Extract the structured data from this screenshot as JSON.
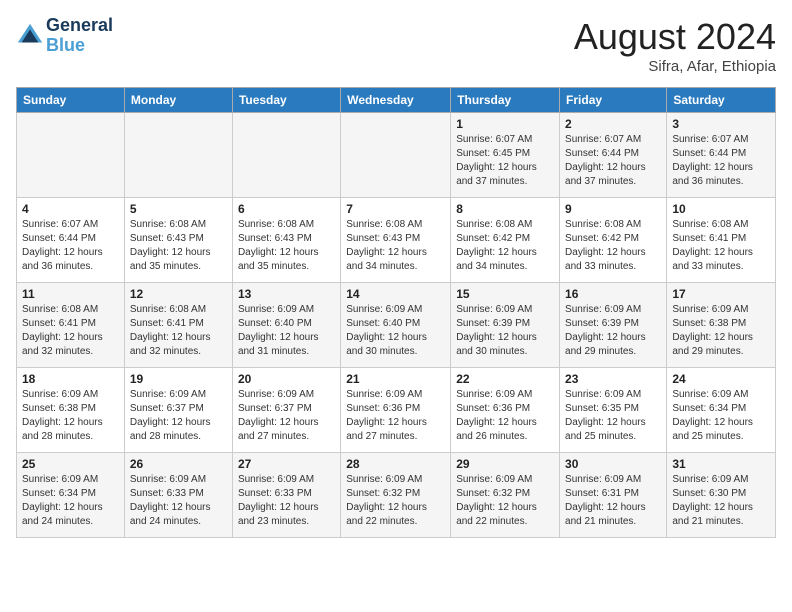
{
  "header": {
    "logo_line1": "General",
    "logo_line2": "Blue",
    "month": "August 2024",
    "location": "Sifra, Afar, Ethiopia"
  },
  "weekdays": [
    "Sunday",
    "Monday",
    "Tuesday",
    "Wednesday",
    "Thursday",
    "Friday",
    "Saturday"
  ],
  "weeks": [
    [
      {
        "day": "",
        "info": ""
      },
      {
        "day": "",
        "info": ""
      },
      {
        "day": "",
        "info": ""
      },
      {
        "day": "",
        "info": ""
      },
      {
        "day": "1",
        "info": "Sunrise: 6:07 AM\nSunset: 6:45 PM\nDaylight: 12 hours\nand 37 minutes."
      },
      {
        "day": "2",
        "info": "Sunrise: 6:07 AM\nSunset: 6:44 PM\nDaylight: 12 hours\nand 37 minutes."
      },
      {
        "day": "3",
        "info": "Sunrise: 6:07 AM\nSunset: 6:44 PM\nDaylight: 12 hours\nand 36 minutes."
      }
    ],
    [
      {
        "day": "4",
        "info": "Sunrise: 6:07 AM\nSunset: 6:44 PM\nDaylight: 12 hours\nand 36 minutes."
      },
      {
        "day": "5",
        "info": "Sunrise: 6:08 AM\nSunset: 6:43 PM\nDaylight: 12 hours\nand 35 minutes."
      },
      {
        "day": "6",
        "info": "Sunrise: 6:08 AM\nSunset: 6:43 PM\nDaylight: 12 hours\nand 35 minutes."
      },
      {
        "day": "7",
        "info": "Sunrise: 6:08 AM\nSunset: 6:43 PM\nDaylight: 12 hours\nand 34 minutes."
      },
      {
        "day": "8",
        "info": "Sunrise: 6:08 AM\nSunset: 6:42 PM\nDaylight: 12 hours\nand 34 minutes."
      },
      {
        "day": "9",
        "info": "Sunrise: 6:08 AM\nSunset: 6:42 PM\nDaylight: 12 hours\nand 33 minutes."
      },
      {
        "day": "10",
        "info": "Sunrise: 6:08 AM\nSunset: 6:41 PM\nDaylight: 12 hours\nand 33 minutes."
      }
    ],
    [
      {
        "day": "11",
        "info": "Sunrise: 6:08 AM\nSunset: 6:41 PM\nDaylight: 12 hours\nand 32 minutes."
      },
      {
        "day": "12",
        "info": "Sunrise: 6:08 AM\nSunset: 6:41 PM\nDaylight: 12 hours\nand 32 minutes."
      },
      {
        "day": "13",
        "info": "Sunrise: 6:09 AM\nSunset: 6:40 PM\nDaylight: 12 hours\nand 31 minutes."
      },
      {
        "day": "14",
        "info": "Sunrise: 6:09 AM\nSunset: 6:40 PM\nDaylight: 12 hours\nand 30 minutes."
      },
      {
        "day": "15",
        "info": "Sunrise: 6:09 AM\nSunset: 6:39 PM\nDaylight: 12 hours\nand 30 minutes."
      },
      {
        "day": "16",
        "info": "Sunrise: 6:09 AM\nSunset: 6:39 PM\nDaylight: 12 hours\nand 29 minutes."
      },
      {
        "day": "17",
        "info": "Sunrise: 6:09 AM\nSunset: 6:38 PM\nDaylight: 12 hours\nand 29 minutes."
      }
    ],
    [
      {
        "day": "18",
        "info": "Sunrise: 6:09 AM\nSunset: 6:38 PM\nDaylight: 12 hours\nand 28 minutes."
      },
      {
        "day": "19",
        "info": "Sunrise: 6:09 AM\nSunset: 6:37 PM\nDaylight: 12 hours\nand 28 minutes."
      },
      {
        "day": "20",
        "info": "Sunrise: 6:09 AM\nSunset: 6:37 PM\nDaylight: 12 hours\nand 27 minutes."
      },
      {
        "day": "21",
        "info": "Sunrise: 6:09 AM\nSunset: 6:36 PM\nDaylight: 12 hours\nand 27 minutes."
      },
      {
        "day": "22",
        "info": "Sunrise: 6:09 AM\nSunset: 6:36 PM\nDaylight: 12 hours\nand 26 minutes."
      },
      {
        "day": "23",
        "info": "Sunrise: 6:09 AM\nSunset: 6:35 PM\nDaylight: 12 hours\nand 25 minutes."
      },
      {
        "day": "24",
        "info": "Sunrise: 6:09 AM\nSunset: 6:34 PM\nDaylight: 12 hours\nand 25 minutes."
      }
    ],
    [
      {
        "day": "25",
        "info": "Sunrise: 6:09 AM\nSunset: 6:34 PM\nDaylight: 12 hours\nand 24 minutes."
      },
      {
        "day": "26",
        "info": "Sunrise: 6:09 AM\nSunset: 6:33 PM\nDaylight: 12 hours\nand 24 minutes."
      },
      {
        "day": "27",
        "info": "Sunrise: 6:09 AM\nSunset: 6:33 PM\nDaylight: 12 hours\nand 23 minutes."
      },
      {
        "day": "28",
        "info": "Sunrise: 6:09 AM\nSunset: 6:32 PM\nDaylight: 12 hours\nand 22 minutes."
      },
      {
        "day": "29",
        "info": "Sunrise: 6:09 AM\nSunset: 6:32 PM\nDaylight: 12 hours\nand 22 minutes."
      },
      {
        "day": "30",
        "info": "Sunrise: 6:09 AM\nSunset: 6:31 PM\nDaylight: 12 hours\nand 21 minutes."
      },
      {
        "day": "31",
        "info": "Sunrise: 6:09 AM\nSunset: 6:30 PM\nDaylight: 12 hours\nand 21 minutes."
      }
    ]
  ]
}
